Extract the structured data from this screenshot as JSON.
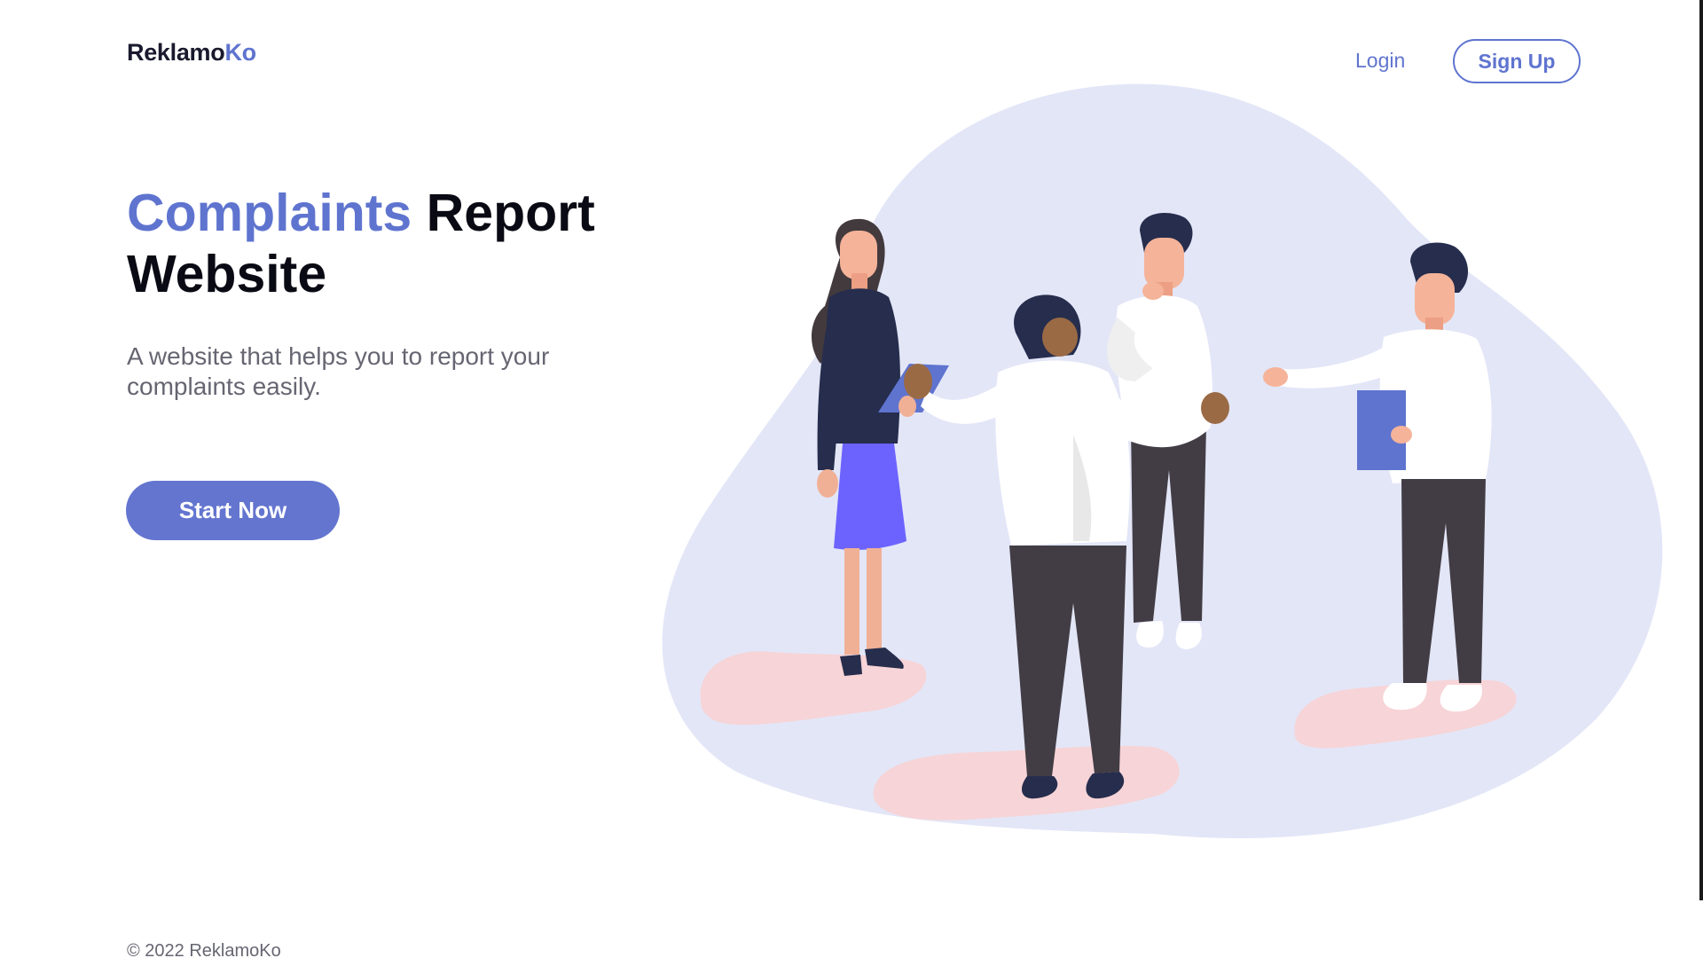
{
  "header": {
    "brand_main": "Reklamo",
    "brand_accent": "Ko",
    "login_label": "Login",
    "signup_label": "Sign Up"
  },
  "hero": {
    "title_accent": "Complaints",
    "title_rest": " Report Website",
    "subtitle": "A website that helps you to report your complaints easily.",
    "cta_label": "Start Now"
  },
  "footer": {
    "copyright": "© 2022 ReklamoKo"
  },
  "colors": {
    "accent": "#5f74cf",
    "blob": "#e3e6f7",
    "floor_pink": "#f7d4d7",
    "skirt": "#6c63ff",
    "navy": "#262d4d",
    "trousers": "#423d45"
  }
}
